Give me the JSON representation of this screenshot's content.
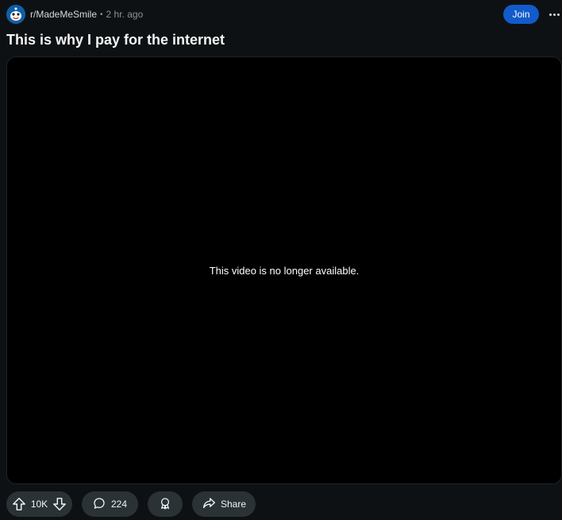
{
  "post": {
    "subreddit": "r/MadeMeSmile",
    "separator": "•",
    "time_ago": "2 hr. ago",
    "join_label": "Join",
    "title": "This is why I pay for the internet",
    "video_message": "This video is no longer available."
  },
  "actions": {
    "vote_count": "10K",
    "comment_count": "224",
    "share_label": "Share"
  },
  "colors": {
    "background": "#0e1113",
    "join_button": "#115bca",
    "pill": "#2a3236"
  },
  "icons": [
    "subreddit-avatar-icon",
    "more-options-icon",
    "upvote-icon",
    "downvote-icon",
    "comment-icon",
    "award-icon",
    "share-icon"
  ]
}
